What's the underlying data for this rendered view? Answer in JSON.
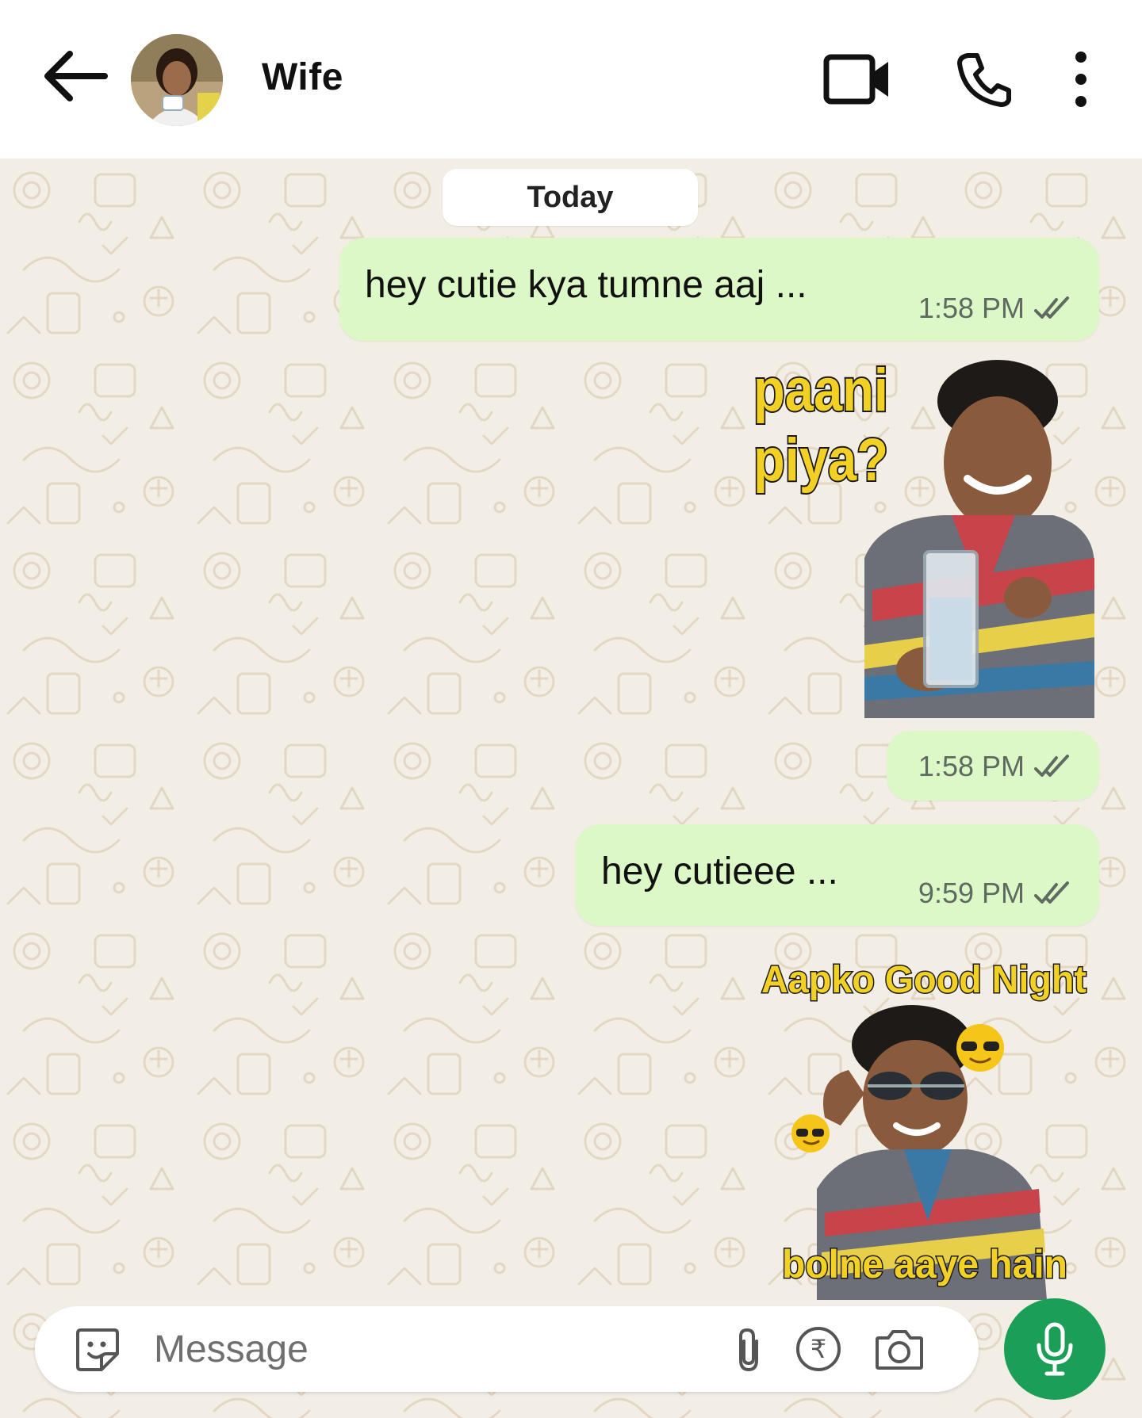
{
  "header": {
    "contact_name": "Wife"
  },
  "chat": {
    "date_label": "Today",
    "messages": [
      {
        "text": "hey cutie kya tumne aaj ...",
        "time": "1:58 PM",
        "status": "read"
      },
      {
        "time": "1:58 PM",
        "status": "read"
      },
      {
        "text": "hey cutieee ...",
        "time": "9:59 PM",
        "status": "read"
      }
    ],
    "stickers": [
      {
        "lines": [
          "paani",
          "piya?"
        ]
      },
      {
        "top_text": "Aapko Good Night",
        "bottom_text": "bolne aaye hain"
      }
    ]
  },
  "composer": {
    "placeholder": "Message",
    "currency_symbol": "₹"
  },
  "colors": {
    "outgoing_bubble": "#dcf8c6",
    "mic_button": "#1b9e55",
    "read_ticks": "#5f6b62",
    "sticker_text": "#f2d024"
  }
}
